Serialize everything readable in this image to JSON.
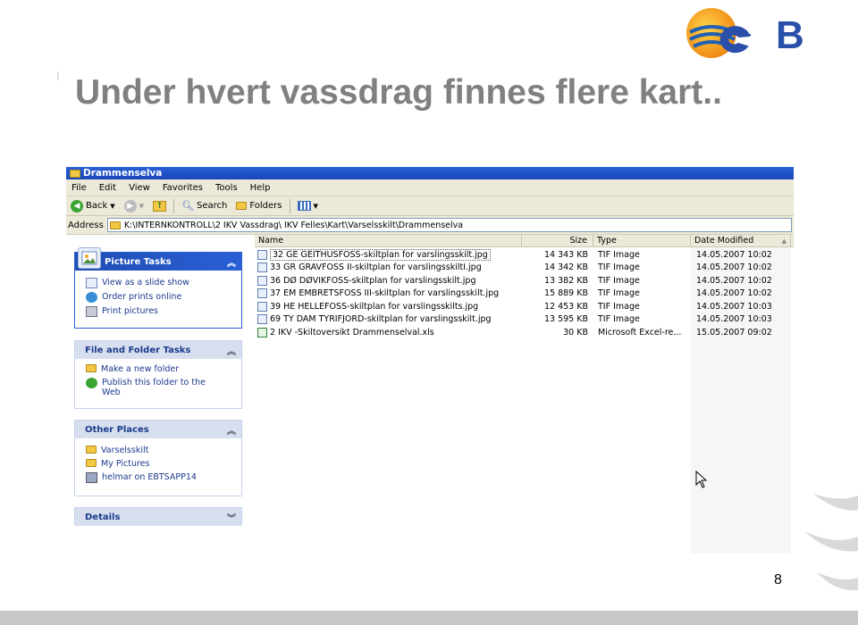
{
  "slide": {
    "title": "Under hvert vassdrag finnes flere kart..",
    "page_number": "8",
    "logo_text": "eB"
  },
  "window": {
    "title": "Drammenselva",
    "menu": [
      "File",
      "Edit",
      "View",
      "Favorites",
      "Tools",
      "Help"
    ],
    "toolbar": {
      "back_label": "Back",
      "search_label": "Search",
      "folders_label": "Folders"
    },
    "address": {
      "label": "Address",
      "path": "K:\\INTERNKONTROLL\\2 IKV Vassdrag\\ IKV Felles\\Kart\\Varselsskilt\\Drammenselva"
    }
  },
  "task_panels": {
    "picture_tasks": {
      "title": "Picture Tasks",
      "items": [
        "View as a slide show",
        "Order prints online",
        "Print pictures"
      ]
    },
    "file_folder_tasks": {
      "title": "File and Folder Tasks",
      "items": [
        "Make a new folder",
        "Publish this folder to the Web"
      ]
    },
    "other_places": {
      "title": "Other Places",
      "items": [
        "Varselsskilt",
        "My Pictures",
        "helmar on EBTSAPP14"
      ]
    },
    "details": {
      "title": "Details"
    }
  },
  "file_list": {
    "columns": {
      "name": "Name",
      "size": "Size",
      "type": "Type",
      "date": "Date Modified"
    },
    "rows": [
      {
        "name": "32 GE GEITHUSFOSS-skiltplan for varslingsskilt.jpg",
        "size": "14 343 KB",
        "type": "TIF Image",
        "date": "14.05.2007 10:02"
      },
      {
        "name": "33 GR GRAVFOSS II-skiltplan for varslingsskiltI.jpg",
        "size": "14 342 KB",
        "type": "TIF Image",
        "date": "14.05.2007 10:02"
      },
      {
        "name": "36 DØ DØVIKFOSS-skiltplan for varslingsskilt.jpg",
        "size": "13 382 KB",
        "type": "TIF Image",
        "date": "14.05.2007 10:02"
      },
      {
        "name": "37 EM EMBRETSFOSS III-skiltplan for varslingsskilt.jpg",
        "size": "15 889 KB",
        "type": "TIF Image",
        "date": "14.05.2007 10:02"
      },
      {
        "name": "39 HE HELLEFOSS-skiltplan for varslingsskilts.jpg",
        "size": "12 453 KB",
        "type": "TIF Image",
        "date": "14.05.2007 10:03"
      },
      {
        "name": "69 TY DAM TYRIFJORD-skiltplan for varslingsskilt.jpg",
        "size": "13 595 KB",
        "type": "TIF Image",
        "date": "14.05.2007 10:03"
      },
      {
        "name": "2 IKV -Skiltoversikt Drammenselval.xls",
        "size": "30 KB",
        "type": "Microsoft Excel-re...",
        "date": "15.05.2007 09:02"
      }
    ]
  },
  "colors": {
    "title_gray": "#808080",
    "xp_blue": "#2a5fd6",
    "logo_blue": "#2a4fa8",
    "logo_orange": "#f39a1e"
  }
}
